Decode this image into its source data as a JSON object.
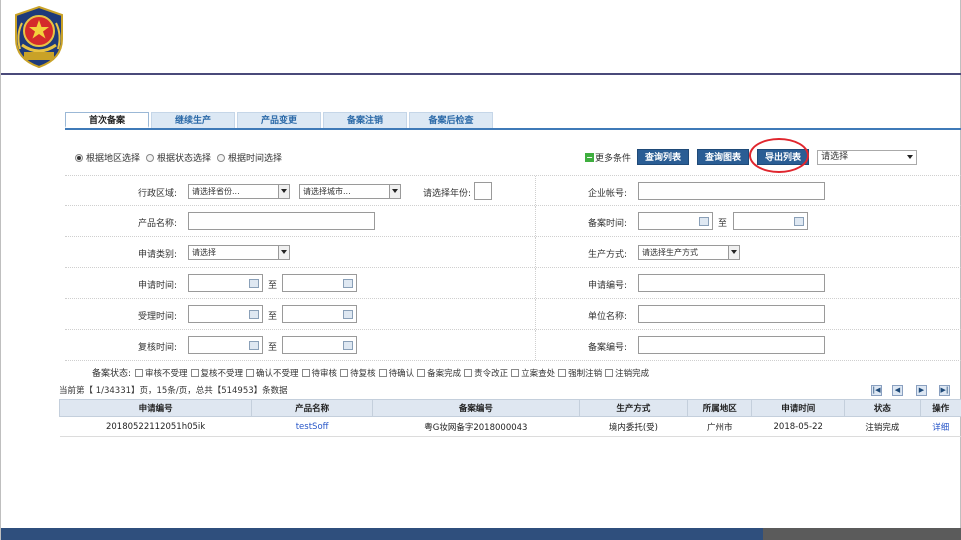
{
  "tabs": [
    {
      "label": "首次备案",
      "active": true
    },
    {
      "label": "继续生产",
      "active": false
    },
    {
      "label": "产品变更",
      "active": false
    },
    {
      "label": "备案注销",
      "active": false
    },
    {
      "label": "备案后检查",
      "active": false
    }
  ],
  "radios": [
    {
      "label": "根据地区选择",
      "checked": true
    },
    {
      "label": "根据状态选择",
      "checked": false
    },
    {
      "label": "根据时间选择",
      "checked": false
    }
  ],
  "toolbar": {
    "more_label": "更多条件",
    "more_icon": "minus",
    "query_list": "查询列表",
    "query_chart": "查询图表",
    "export_list": "导出列表",
    "select_value": "请选择"
  },
  "form": {
    "region_label": "行政区域:",
    "province_value": "请选择省份...",
    "city_value": "请选择城市...",
    "year_label": "请选择年份:",
    "company_account_label": "企业帐号:",
    "product_name_label": "产品名称:",
    "record_time_label": "备案时间:",
    "apply_category_label": "申请类别:",
    "apply_category_value": "请选择",
    "production_method_label": "生产方式:",
    "production_method_value": "请选择生产方式",
    "apply_time_label": "申请时间:",
    "apply_no_label": "申请编号:",
    "accept_time_label": "受理时间:",
    "unit_name_label": "单位名称:",
    "review_time_label": "复核时间:",
    "record_no_label": "备案编号:",
    "to": "至"
  },
  "status": {
    "label": "备案状态:",
    "options": [
      "审核不受理",
      "复核不受理",
      "确认不受理",
      "待审核",
      "待复核",
      "待确认",
      "备案完成",
      "责令改正",
      "立案查处",
      "强制注销",
      "注销完成"
    ]
  },
  "pager": {
    "text": "当前第【 1/34331】页，15条/页，总共【514953】条数据",
    "buttons": [
      "|◀",
      "◀",
      "▶",
      "▶|"
    ]
  },
  "table": {
    "headers": [
      "申请编号",
      "产品名称",
      "备案编号",
      "生产方式",
      "所属地区",
      "申请时间",
      "状态",
      "操作"
    ],
    "rows": [
      [
        "20180522112051h05ik",
        "testSoff",
        "粤G妆网备字2018000043",
        "境内委托(受)",
        "广州市",
        "2018-05-22",
        "注销完成",
        "详细"
      ]
    ]
  },
  "colors": {
    "accent": "#2a5d94",
    "highlight_circle": "#e0262e",
    "footer": "#2f4f7d",
    "link": "#2655c8"
  }
}
